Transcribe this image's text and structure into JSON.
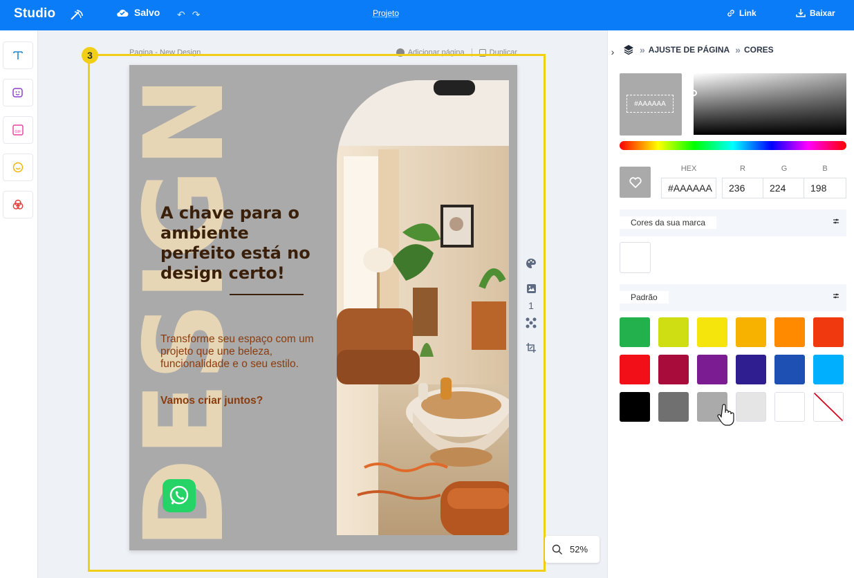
{
  "topbar": {
    "brand": "Studio",
    "save_status": "Salvo",
    "undo_icon": "↶",
    "redo_icon": "↷",
    "project_label": "Projeto",
    "link_label": "Link",
    "download_label": "Baixar"
  },
  "sidebar": {
    "tools": [
      "text-icon",
      "image-sticker-icon",
      "gif-icon",
      "emoji-icon",
      "shapes-icon"
    ]
  },
  "canvas": {
    "page_label": "Pagina - New Design",
    "add_page_label": "Adicionar página",
    "duplicate_label": "Duplicar",
    "selection_number": "3",
    "page_number": "1",
    "zoom_level": "52%",
    "design": {
      "headline": "A chave para o ambiente perfeito está no design certo!",
      "body": "Transforme seu espaço com um projeto que une beleza, funcionalidade e o seu estilo.",
      "cta": "Vamos criar juntos?",
      "vertical_word": "DESIGN",
      "background_color": "#aaaaaa"
    }
  },
  "panel": {
    "breadcrumb": [
      "AJUSTE DE PÁGINA",
      "CORES"
    ],
    "preview_hex": "#AAAAAA",
    "hex_label": "HEX",
    "r_label": "R",
    "g_label": "G",
    "b_label": "B",
    "hex_value": "#AAAAAA",
    "r_value": "236",
    "g_value": "224",
    "b_value": "198",
    "brand_colors_title": "Cores da sua marca",
    "default_title": "Padrão",
    "swatches": [
      "#22b14c",
      "#cfde12",
      "#f5e50d",
      "#f7b200",
      "#ff8a00",
      "#f0390f",
      "#f20f17",
      "#a80c3a",
      "#7b1c93",
      "#2e1e8f",
      "#1e50b4",
      "#00b0ff",
      "#000000",
      "#707070",
      "#aaaaaa",
      "#e5e5e5",
      "#ffffff",
      "transparent"
    ]
  }
}
